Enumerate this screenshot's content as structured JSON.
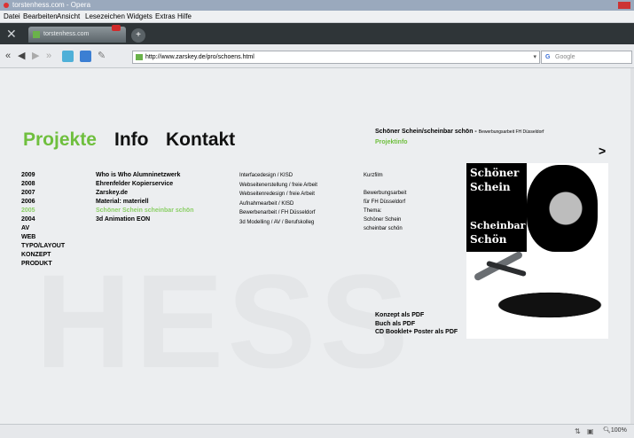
{
  "window": {
    "title": "torstenhess.com - Opera"
  },
  "menu": [
    "Datei",
    "Bearbeiten",
    "Ansicht",
    "Lesezeichen",
    "Widgets",
    "Extras",
    "Hilfe"
  ],
  "tab": {
    "label": "torstenhess.com"
  },
  "address": {
    "url": "http://www.zarskey.de/pro/schoens.html",
    "search_placeholder": "Google"
  },
  "site": {
    "nav": {
      "projects": "Projekte",
      "info": "Info",
      "contact": "Kontakt"
    },
    "headline": "Schöner Schein/scheinbar schön -",
    "headline_sub": "Bewerbungsarbeit FH Düsseldorf",
    "project_info": "Projektinfo",
    "arrow": ">",
    "years": [
      "2009",
      "2008",
      "2007",
      "2006",
      "2005",
      "2004",
      "AV",
      "WEB",
      "TYPO/LAYOUT",
      "KONZEPT",
      "PRODUKT"
    ],
    "projects": [
      "Who is Who Alumninetzwerk",
      "Ehrenfelder Kopierservice",
      "Zarskey.de",
      "Material: materiell",
      "Schöner Schein scheinbar schön",
      "3d Animation EON"
    ],
    "descriptions": [
      "Interfacedesign / KISD",
      "Webseitenerstellung / freie Arbeit",
      "Webseitenredesign / freie Arbeit",
      "Aufnahmearbeit / KISD",
      "Bewerbenarbeit / FH Düsseldorf",
      "3d Modelling / AV / Berufskolleg"
    ],
    "info": [
      "Kurzfilm",
      "",
      "Bewerbungsarbeit",
      "für FH Düsseldorf",
      "Thema:",
      "Schöner Schein",
      "scheinbar schön"
    ],
    "art": {
      "line1": "Schöner",
      "line2": "Schein",
      "line3": "Scheinbar",
      "line4": "Schön"
    },
    "pdf": [
      "Konzept als PDF",
      "Buch als PDF",
      "CD Booklet+ Poster als PDF"
    ],
    "watermark": "HESS"
  },
  "status": {
    "zoom": "100%"
  }
}
